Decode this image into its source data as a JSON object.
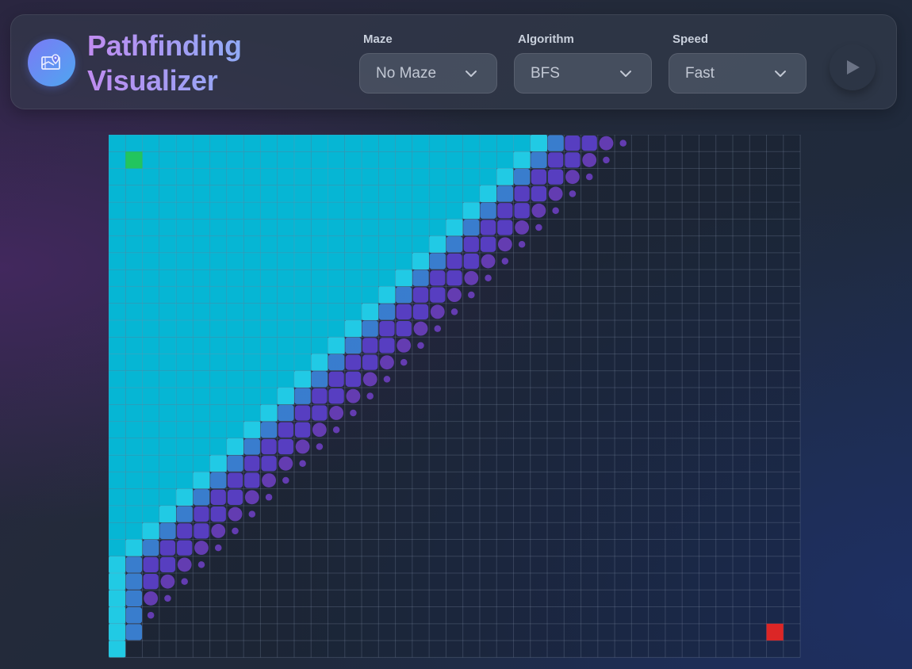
{
  "app": {
    "title": "Pathfinding Visualizer",
    "logo_icon": "map-pin-icon"
  },
  "controls": {
    "maze": {
      "label": "Maze",
      "value": "No Maze"
    },
    "algorithm": {
      "label": "Algorithm",
      "value": "BFS"
    },
    "speed": {
      "label": "Speed",
      "value": "Fast"
    },
    "play": {
      "icon": "play-icon"
    }
  },
  "grid": {
    "cols": 41,
    "rows": 31,
    "start": {
      "col": 1,
      "row": 1,
      "color": "#22c55e"
    },
    "end": {
      "col": 39,
      "row": 29,
      "color": "#dc2626"
    },
    "frontier_band": [
      [
        0,
        25,
        30
      ],
      [
        1,
        24,
        29
      ],
      [
        2,
        23,
        28
      ],
      [
        3,
        22,
        27
      ],
      [
        4,
        21,
        26
      ],
      [
        5,
        20,
        25
      ],
      [
        6,
        19,
        24
      ],
      [
        7,
        18,
        23
      ],
      [
        8,
        17,
        22
      ],
      [
        9,
        16,
        21
      ],
      [
        10,
        15,
        20
      ],
      [
        11,
        14,
        19
      ],
      [
        12,
        13,
        18
      ],
      [
        13,
        12,
        17
      ],
      [
        14,
        11,
        16
      ],
      [
        15,
        10,
        15
      ],
      [
        16,
        9,
        14
      ],
      [
        17,
        8,
        13
      ],
      [
        18,
        7,
        12
      ],
      [
        19,
        6,
        11
      ],
      [
        20,
        5,
        10
      ],
      [
        21,
        4,
        9
      ],
      [
        22,
        3,
        8
      ],
      [
        23,
        2,
        7
      ],
      [
        24,
        1,
        6
      ],
      [
        25,
        0,
        5
      ],
      [
        26,
        0,
        4
      ],
      [
        27,
        0,
        3
      ],
      [
        28,
        0,
        2
      ],
      [
        29,
        0,
        1
      ],
      [
        30,
        0,
        0
      ]
    ],
    "colors": {
      "visited": "#06b6d4",
      "frontier_new": "#22d3ee",
      "frontier_mid": "#3b82d6",
      "frontier_deep": "#5b3fc8",
      "queued": "#6b3fbf",
      "empty": "rgba(20,28,42,0.35)",
      "line": "rgba(130,145,170,0.28)"
    }
  }
}
